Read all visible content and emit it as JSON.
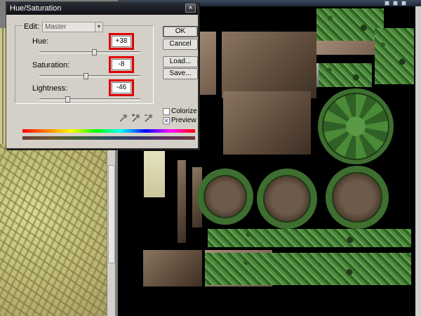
{
  "dialog": {
    "title": "Hue/Saturation",
    "close_glyph": "×",
    "edit_label": "Edit:",
    "edit_value": "Master",
    "hue": {
      "label": "Hue:",
      "value": "+38",
      "slider": 0.55
    },
    "saturation": {
      "label": "Saturation:",
      "value": "-8",
      "slider": 0.46
    },
    "lightness": {
      "label": "Lightness:",
      "value": "-46",
      "slider": 0.27
    },
    "buttons": {
      "ok": "OK",
      "cancel": "Cancel",
      "load": "Load...",
      "save": "Save..."
    },
    "colorize_label": "Colorize",
    "colorize_checked": false,
    "preview_label": "Preview",
    "preview_checked": true,
    "icons": [
      "eyedropper-icon",
      "eyedropper-plus-icon",
      "eyedropper-minus-icon"
    ]
  },
  "colors": {
    "highlight": "#e00000",
    "dialog_bg": "#d4d0c8",
    "titlebar": "#15181d"
  }
}
